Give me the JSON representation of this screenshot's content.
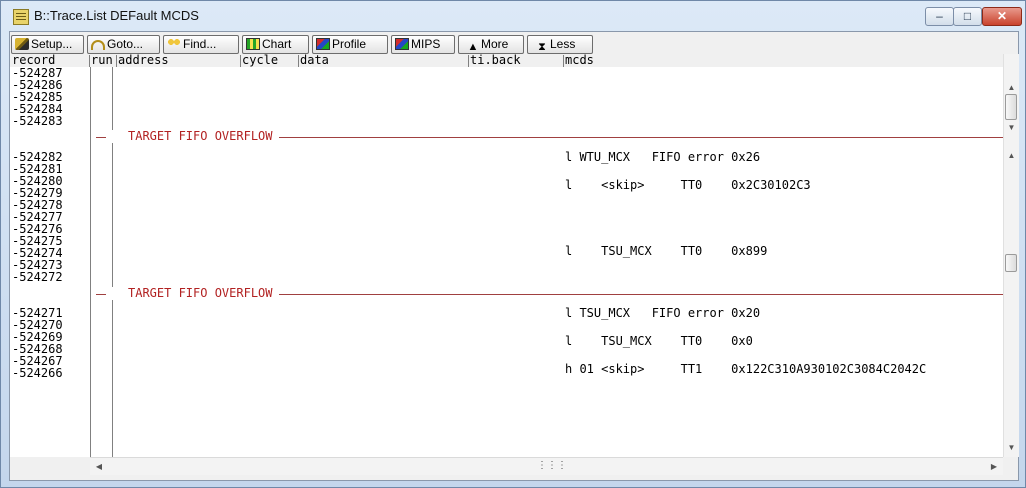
{
  "window": {
    "title": "B::Trace.List DEFault MCDS"
  },
  "toolbar": {
    "setup": "Setup...",
    "goto": "Goto...",
    "find": "Find...",
    "chart": "Chart",
    "profile": "Profile",
    "mips": "MIPS",
    "more": "More",
    "less": "Less"
  },
  "columns": {
    "record": "record",
    "run": "run",
    "address": "address",
    "cycle": "cycle",
    "data": "data",
    "tiback": "ti.back",
    "mcds": "mcds"
  },
  "overflow_label": "TARGET FIFO OVERFLOW",
  "records": [
    "-524287",
    "-524286",
    "-524285",
    "-524284",
    "-524283",
    "-524282",
    "-524281",
    "-524280",
    "-524279",
    "-524278",
    "-524277",
    "-524276",
    "-524275",
    "-524274",
    "-524273",
    "-524272",
    "-524271",
    "-524270",
    "-524269",
    "-524268",
    "-524267",
    "-524266"
  ],
  "mcds_entries": [
    {
      "text": "l WTU_MCX   FIFO error 0x26"
    },
    {
      "text": "l    <skip>     TT0    0x2C30102C3"
    },
    {
      "text": "l    TSU_MCX    TT0    0x899"
    },
    {
      "text": "l TSU_MCX   FIFO error 0x20"
    },
    {
      "text": "l    TSU_MCX    TT0    0x0"
    },
    {
      "text": "h 01 <skip>     TT1    0x122C310A930102C3084C2042C"
    }
  ],
  "colors": {
    "overflow": "#b22222",
    "accent": "#6f88a8"
  }
}
